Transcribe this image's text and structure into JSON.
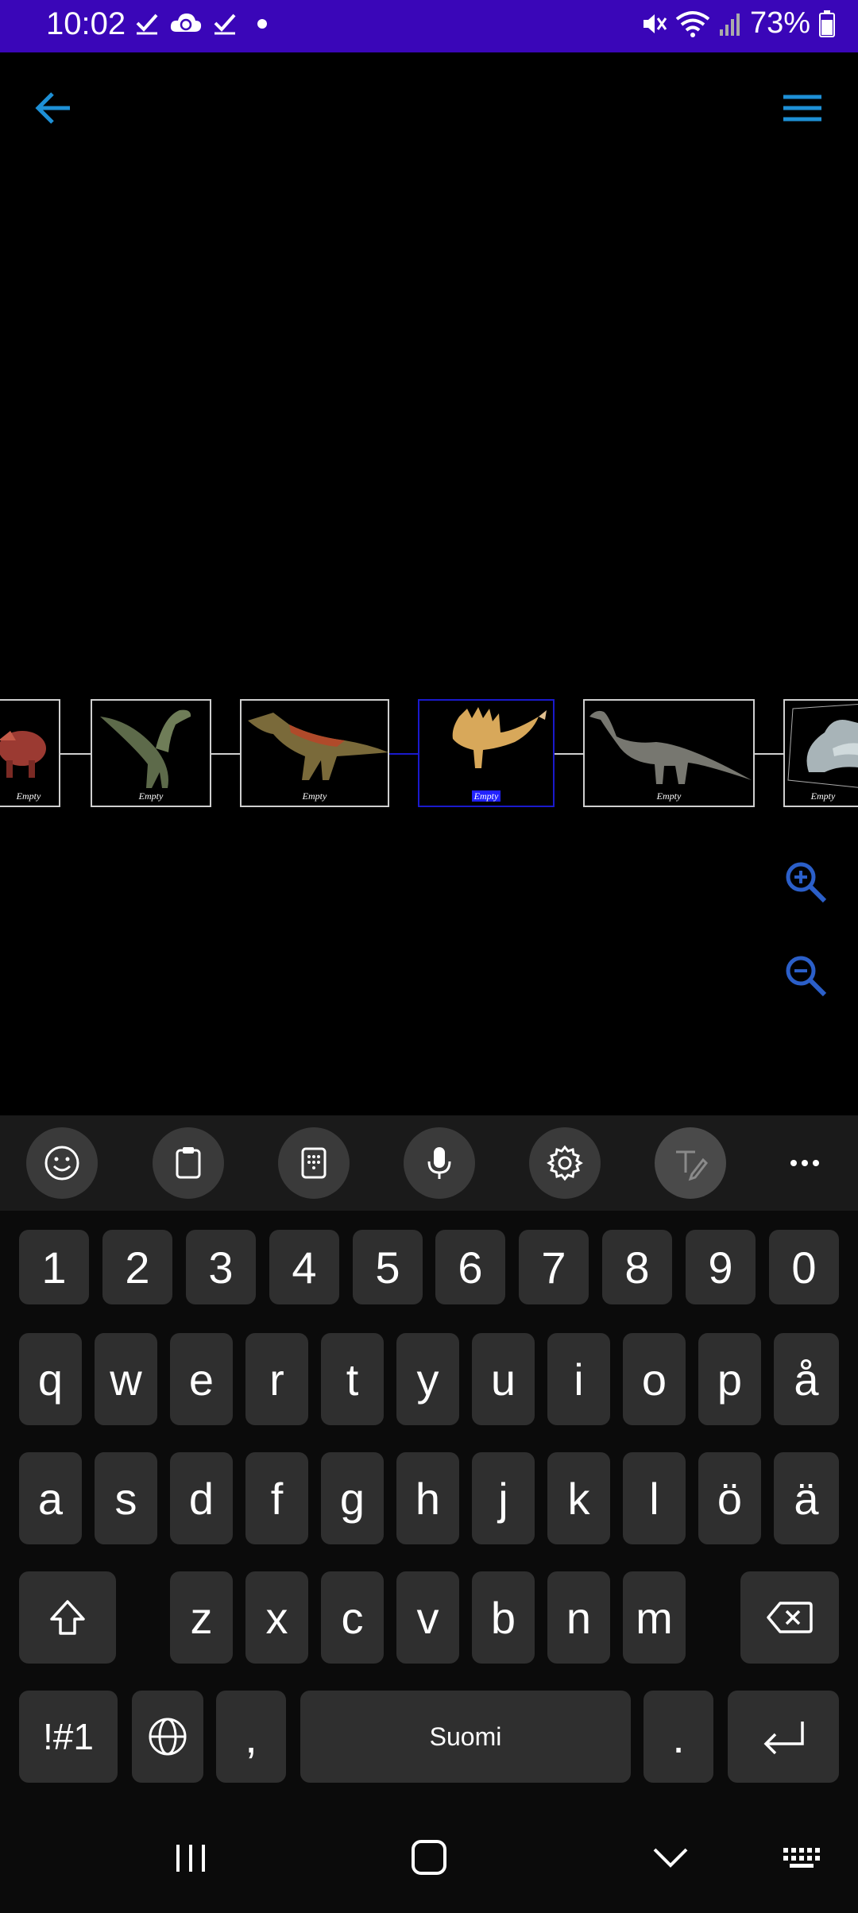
{
  "status": {
    "time": "10:02",
    "battery": "73%",
    "icons": [
      "check-icon",
      "cloud-sync-icon",
      "check-icon",
      "dot-icon",
      "mute-icon",
      "wifi-icon",
      "signal-icon",
      "battery-icon"
    ]
  },
  "appbar": {
    "back_icon": "arrow-left-icon",
    "menu_icon": "hamburger-menu-icon",
    "accent": "#1e90d6"
  },
  "timeline": {
    "nodes": [
      {
        "caption": "Empty",
        "creature": "triceratops"
      },
      {
        "caption": "Empty",
        "creature": "raptor"
      },
      {
        "caption": "Empty",
        "creature": "crocodile-dinosaur"
      },
      {
        "caption": "Empty",
        "creature": "spinosaurus",
        "selected": true
      },
      {
        "caption": "Empty",
        "creature": "sauropod"
      },
      {
        "caption": "Empty",
        "creature": "plesiosaur"
      }
    ]
  },
  "zoom": {
    "in_icon": "zoom-in-icon",
    "out_icon": "zoom-out-icon",
    "color": "#2b5fc9"
  },
  "keyboard": {
    "toolbar": [
      "emoji-icon",
      "clipboard-icon",
      "keypad-icon",
      "microphone-icon",
      "gear-icon",
      "handwriting-icon",
      "more-icon"
    ],
    "row_numbers": [
      "1",
      "2",
      "3",
      "4",
      "5",
      "6",
      "7",
      "8",
      "9",
      "0"
    ],
    "row_q": [
      "q",
      "w",
      "e",
      "r",
      "t",
      "y",
      "u",
      "i",
      "o",
      "p",
      "å"
    ],
    "row_a": [
      "a",
      "s",
      "d",
      "f",
      "g",
      "h",
      "j",
      "k",
      "l",
      "ö",
      "ä"
    ],
    "row_z": [
      "z",
      "x",
      "c",
      "v",
      "b",
      "n",
      "m"
    ],
    "symbols_label": "!#1",
    "comma": ",",
    "space_label": "Suomi",
    "period": "."
  },
  "navbar": [
    "recent-apps-icon",
    "home-icon",
    "back-chevron-icon",
    "keyboard-icon"
  ]
}
